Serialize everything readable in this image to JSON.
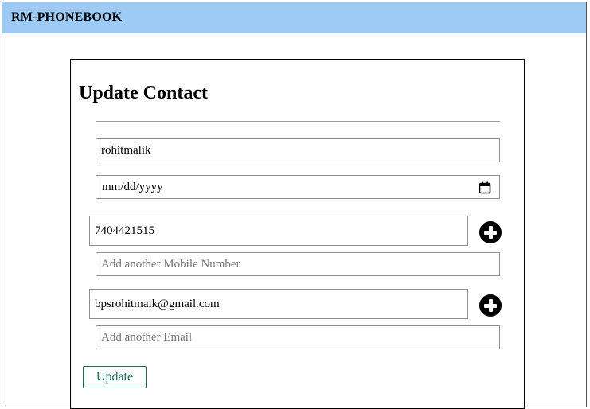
{
  "app": {
    "brand": "RM-PHONEBOOK"
  },
  "form": {
    "title": "Update Contact",
    "name_value": "rohitmalik",
    "dob_placeholder": "mm/dd/yyyy",
    "mobile_value": "7404421515",
    "mobile2_placeholder": "Add another Mobile Number",
    "email_value": "bpsrohitmaik@gmail.com",
    "email2_placeholder": "Add another Email",
    "update_label": "Update"
  },
  "icons": {
    "add_mobile": "plus-circle-icon",
    "add_email": "plus-circle-icon",
    "calendar": "calendar-icon"
  },
  "colors": {
    "navbar": "#9ecbf5",
    "button_accent": "#1d6b5a"
  }
}
